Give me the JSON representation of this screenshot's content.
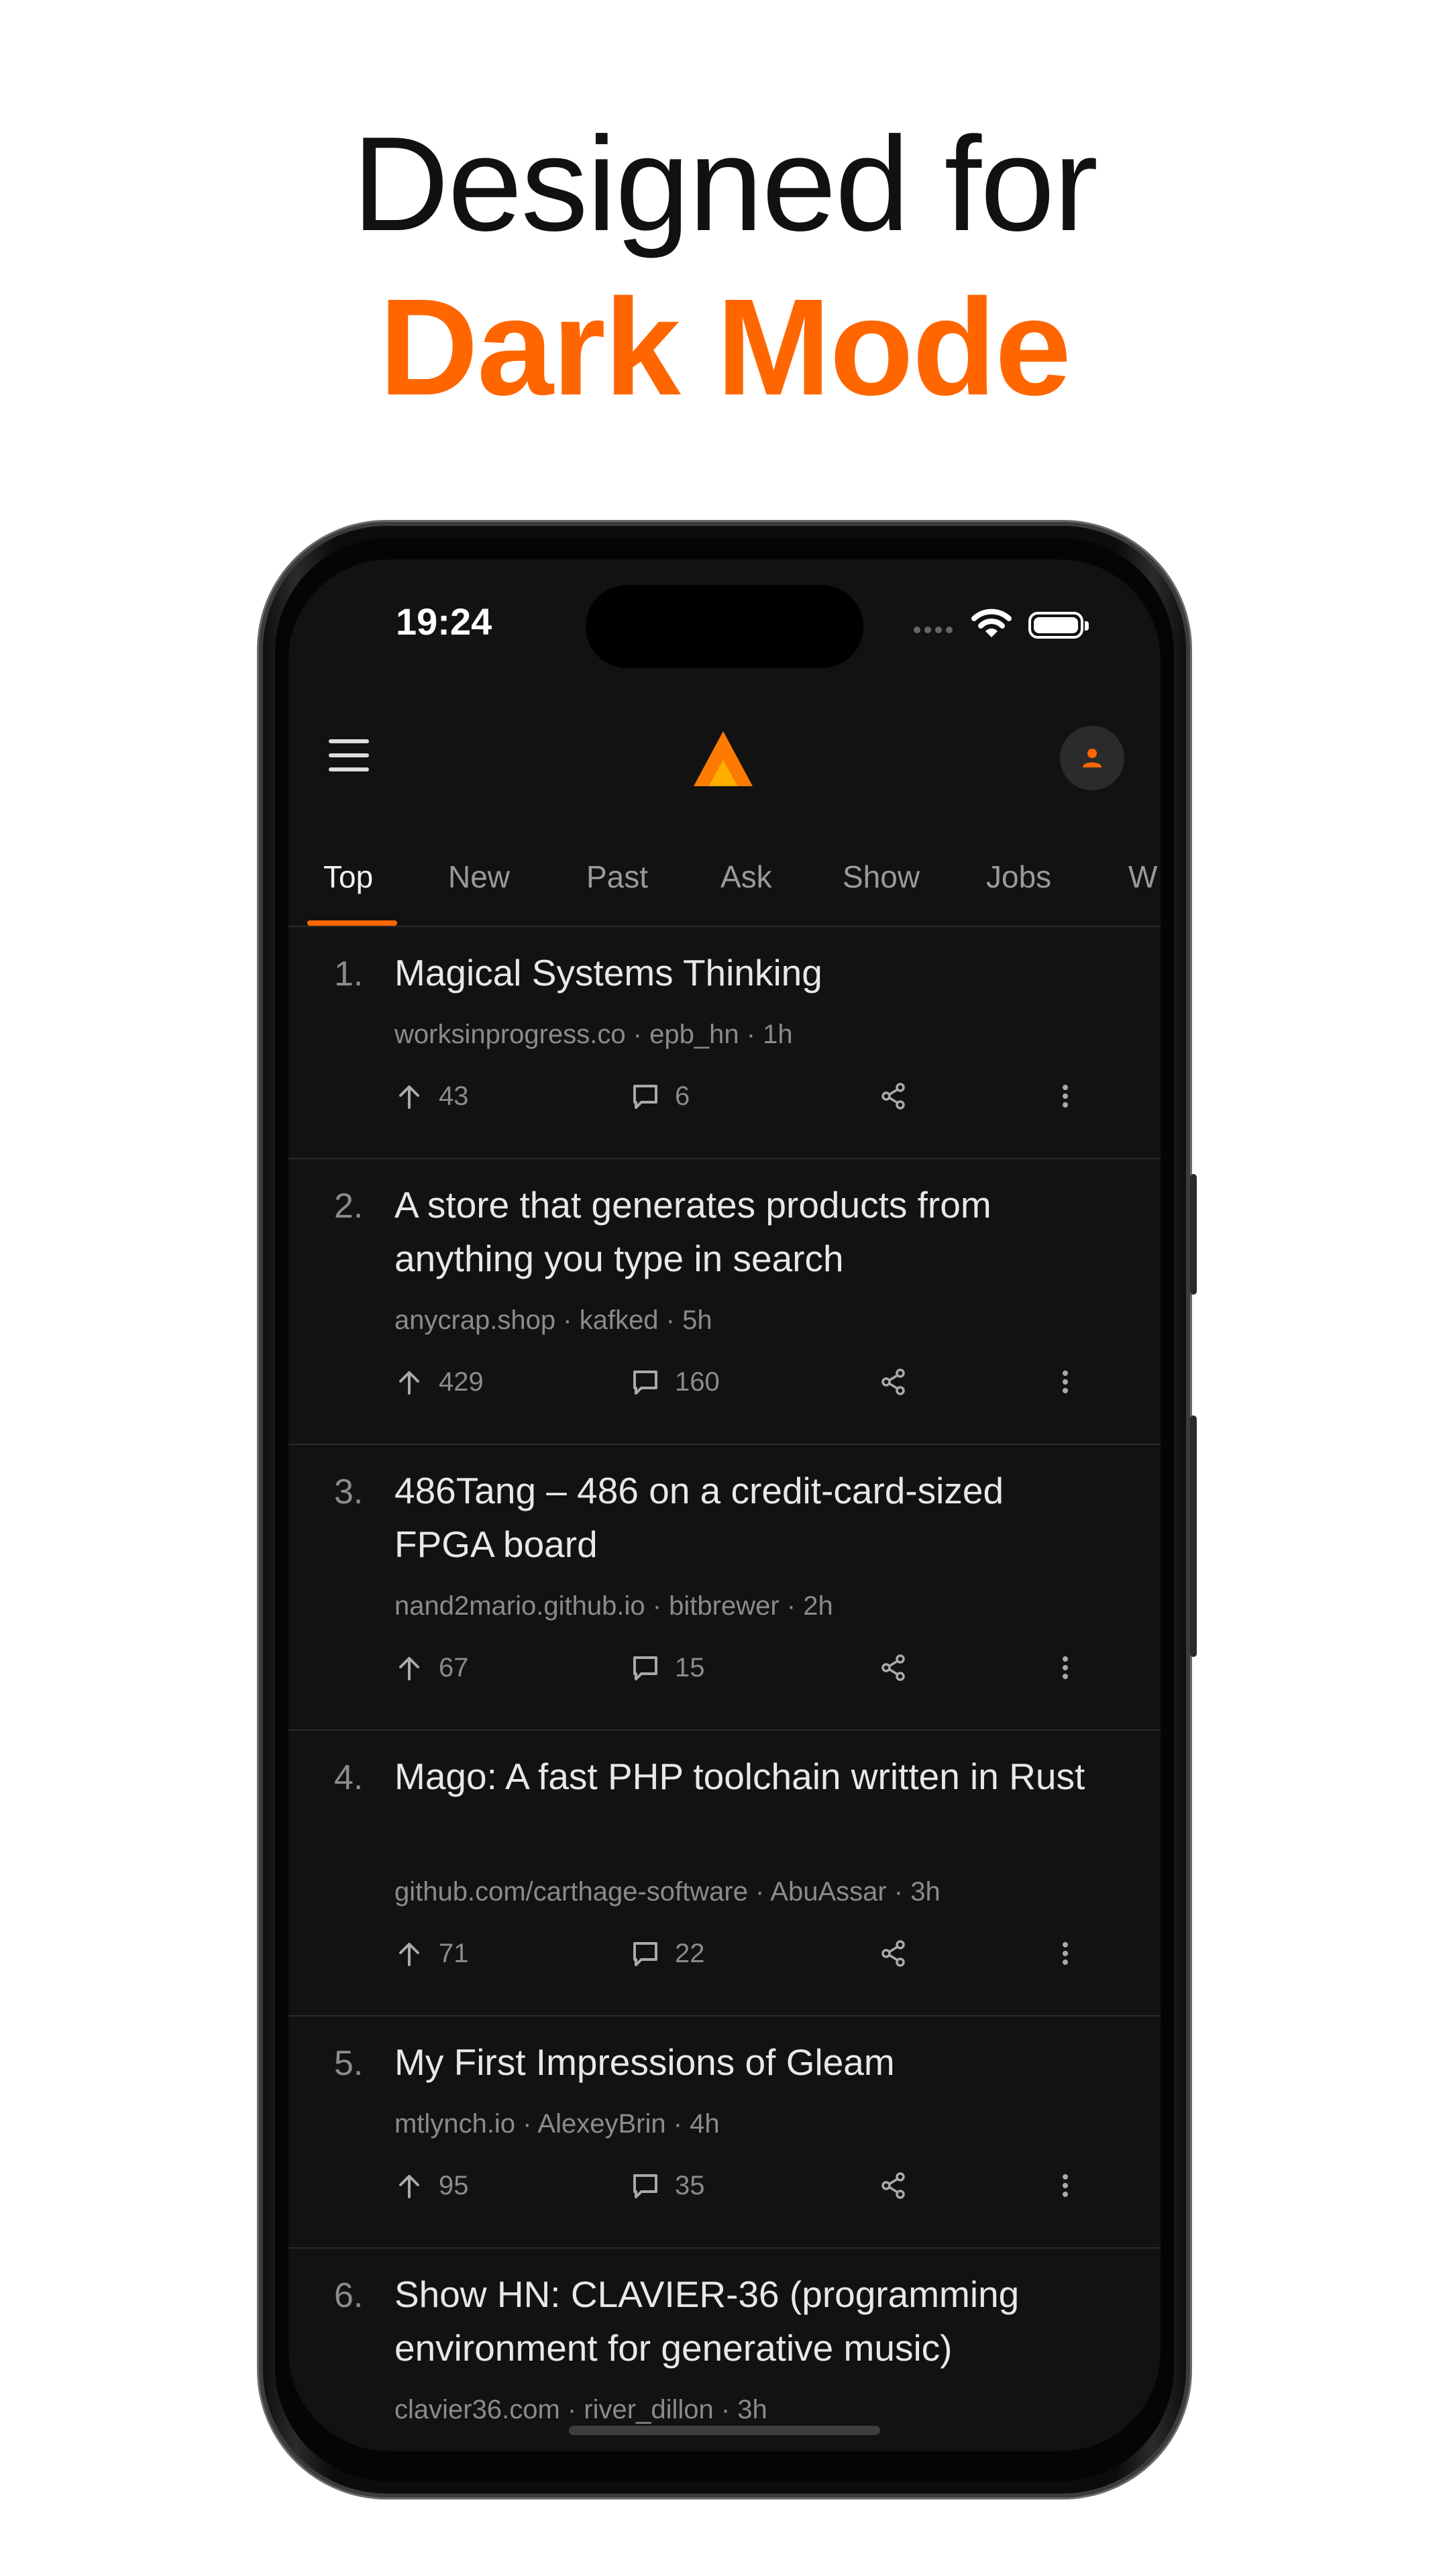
{
  "hero": {
    "line1": "Designed for",
    "line2": "Dark Mode",
    "accent": "#ff6600"
  },
  "status": {
    "time": "19:24"
  },
  "tabs": [
    "Top",
    "New",
    "Past",
    "Ask",
    "Show",
    "Jobs",
    "W"
  ],
  "stories": [
    {
      "num": "1.",
      "title": "Magical Systems Thinking",
      "meta": "worksinprogress.co · epb_hn · 1h",
      "points": "43",
      "comments": "6"
    },
    {
      "num": "2.",
      "title": "A store that generates products from anything you type in search",
      "meta": "anycrap.shop · kafked · 5h",
      "points": "429",
      "comments": "160"
    },
    {
      "num": "3.",
      "title": "486Tang – 486 on a credit-card-sized FPGA board",
      "meta": "nand2mario.github.io · bitbrewer · 2h",
      "points": "67",
      "comments": "15"
    },
    {
      "num": "4.",
      "title": "Mago: A fast PHP toolchain written in Rust",
      "meta": "github.com/carthage-software · AbuAssar · 3h",
      "points": "71",
      "comments": "22"
    },
    {
      "num": "5.",
      "title": "My First Impressions of Gleam",
      "meta": "mtlynch.io · AlexeyBrin · 4h",
      "points": "95",
      "comments": "35"
    },
    {
      "num": "6.",
      "title": "Show HN: CLAVIER-36 (programming environment for generative music)",
      "meta": "clavier36.com · river_dillon · 3h"
    }
  ]
}
